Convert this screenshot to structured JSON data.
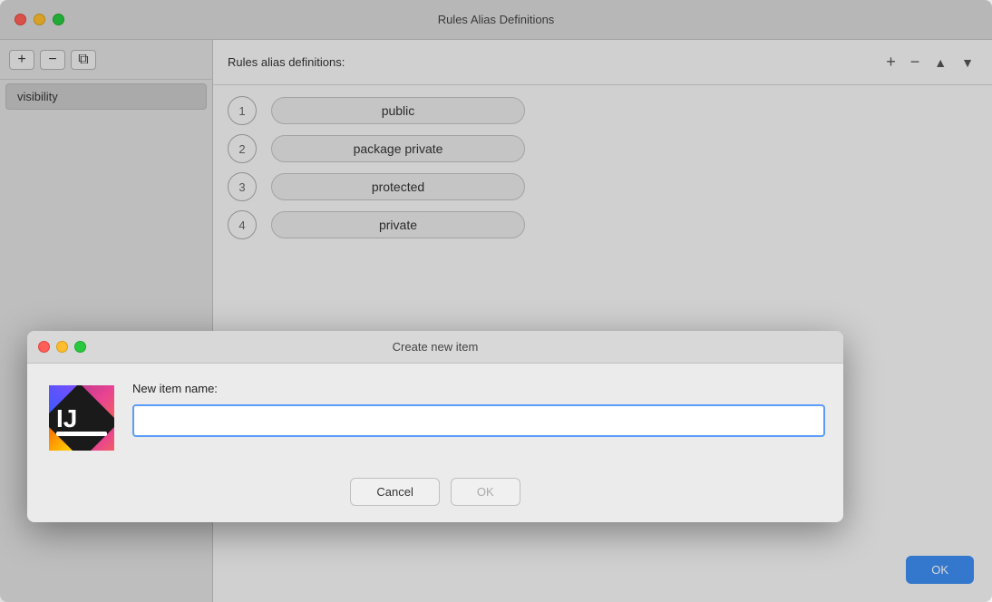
{
  "window": {
    "title": "Rules Alias Definitions",
    "buttons": {
      "close": "close",
      "minimize": "minimize",
      "maximize": "maximize"
    }
  },
  "sidebar": {
    "toolbar": {
      "add_label": "+",
      "remove_label": "−",
      "copy_label": "⧉"
    },
    "items": [
      {
        "label": "visibility",
        "selected": true
      }
    ]
  },
  "main_panel": {
    "header": "Rules alias definitions:",
    "actions": {
      "add": "+",
      "remove": "−",
      "up": "▲",
      "down": "▼"
    },
    "rules": [
      {
        "number": "1",
        "label": "public"
      },
      {
        "number": "2",
        "label": "package private"
      },
      {
        "number": "3",
        "label": "protected"
      },
      {
        "number": "4",
        "label": "private"
      }
    ],
    "ok_button": "OK"
  },
  "dialog": {
    "title": "Create new item",
    "label": "New item name:",
    "input_placeholder": "",
    "buttons": {
      "cancel": "Cancel",
      "ok": "OK"
    }
  }
}
